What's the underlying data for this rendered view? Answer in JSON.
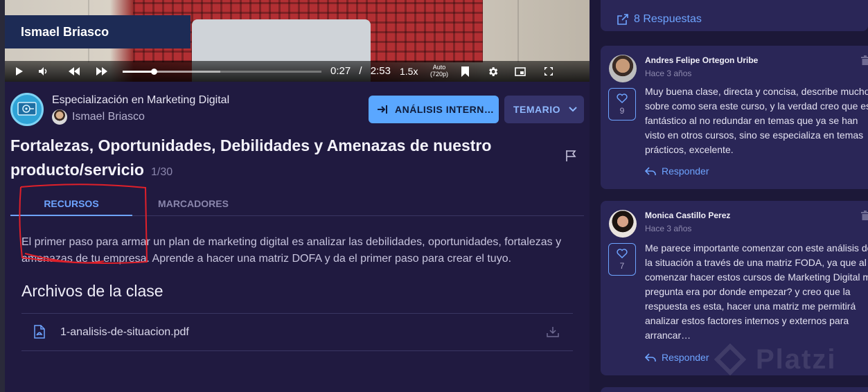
{
  "video": {
    "presenter_name": "Ismael Briasco",
    "current_time": "0:27",
    "separator": "/",
    "duration": "2:53",
    "speed": "1.5x",
    "quality_top": "Auto",
    "quality_bottom": "(720p)",
    "progress": 0.156,
    "buffered": 0.49
  },
  "course": {
    "name": "Especialización en Marketing Digital",
    "teacher": "Ismael Briasco",
    "icon": "marketing-course-icon"
  },
  "buttons": {
    "analysis_label": "ANÁLISIS INTERN…",
    "syllabus_label": "TEMARIO"
  },
  "lesson": {
    "title": "Fortalezas, Oportunidades, Debilidades y Amenazas de nuestro producto/servicio",
    "count": "1/30"
  },
  "tabs": {
    "resources": "RECURSOS",
    "bookmarks": "MARCADORES"
  },
  "description": "El primer paso para armar un plan de marketing digital es analizar las debilidades, oportunidades, fortalezas y amenazas de tu empresa. Aprende a hacer una matriz DOFA y da el primer paso para crear el tuyo.",
  "files": {
    "title": "Archivos de la clase",
    "items": [
      {
        "name": "1-analisis-de-situacion.pdf"
      }
    ]
  },
  "comments": {
    "answers_link": "8 Respuestas",
    "items": [
      {
        "author": "Andres Felipe Ortegon Uribe",
        "date": "Hace 3 años",
        "likes": "9",
        "body": "Muy buena clase, directa y concisa, describe mucho sobre como sera este curso, y la verdad creo que es fantástico al no redundar en temas que ya se han visto en otros cursos, sino se especializa en temas prácticos, excelente.",
        "reply": "Responder"
      },
      {
        "author": "Monica Castillo Perez",
        "date": "Hace 3 años",
        "likes": "7",
        "body": "Me parece importante comenzar con este análisis de la situación a través de una matriz FODA, ya que al comenzar hacer estos cursos de Marketing Digital mi pregunta era por donde empezar? y creo que la respuesta es esta, hacer una matriz me permitirá analizar estos factores internos y externos para arrancar…",
        "reply": "Responder"
      }
    ]
  },
  "watermark": "Platzi",
  "colors": {
    "accent": "#6ea4ff",
    "button_primary": "#5aa7ff",
    "background": "#201a40",
    "card": "#2a2657",
    "annotation": "#e0202a"
  }
}
